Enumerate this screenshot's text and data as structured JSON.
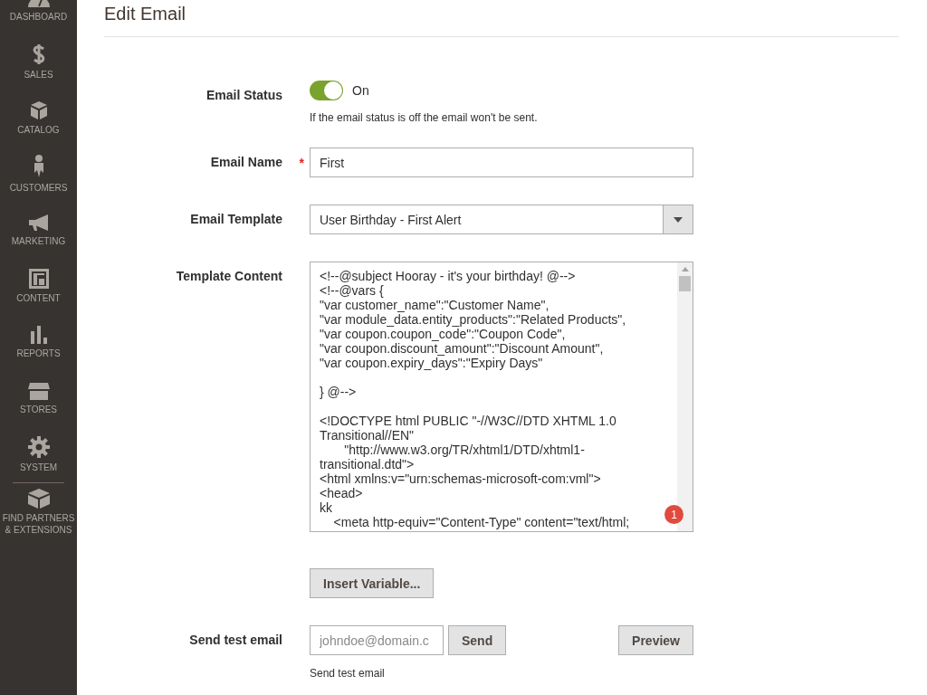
{
  "sidebar": {
    "items": [
      {
        "label": "DASHBOARD",
        "selected": false
      },
      {
        "label": "SALES",
        "selected": false
      },
      {
        "label": "CATALOG",
        "selected": false
      },
      {
        "label": "CUSTOMERS",
        "selected": false
      },
      {
        "label": "MARKETING",
        "selected": false
      },
      {
        "label": "CONTENT",
        "selected": false
      },
      {
        "label": "REPORTS",
        "selected": false
      },
      {
        "label": "STORES",
        "selected": false
      },
      {
        "label": "SYSTEM",
        "selected": false
      },
      {
        "label": "FIND PARTNERS\n& EXTENSIONS",
        "selected": false
      }
    ]
  },
  "page_title": "Edit Email",
  "form": {
    "email_status": {
      "label": "Email Status",
      "on": true,
      "state_label": "On",
      "note": "If the email status is off the email won't be sent."
    },
    "email_name": {
      "label": "Email Name",
      "required_mark": "*",
      "value": "First"
    },
    "email_template": {
      "label": "Email Template",
      "value": "User Birthday - First Alert"
    },
    "template_content": {
      "label": "Template Content",
      "value": "<!--@subject Hooray - it's your birthday! @-->\n<!--@vars {\n\"var customer_name\":\"Customer Name\",\n\"var module_data.entity_products\":\"Related Products\",\n\"var coupon.coupon_code\":\"Coupon Code\",\n\"var coupon.discount_amount\":\"Discount Amount\",\n\"var coupon.expiry_days\":\"Expiry Days\"\n\n} @-->\n\n<!DOCTYPE html PUBLIC \"-//W3C//DTD XHTML 1.0\nTransitional//EN\"\n       \"http://www.w3.org/TR/xhtml1/DTD/xhtml1-\ntransitional.dtd\">\n<html xmlns:v=\"urn:schemas-microsoft-com:vml\">\n<head>\nkk\n    <meta http-equiv=\"Content-Type\" content=\"text/html;",
      "badge": "1"
    },
    "insert_variable_button": "Insert Variable...",
    "send_test": {
      "label": "Send test email",
      "placeholder": "johndoe@domain.c",
      "send_button": "Send",
      "preview_button": "Preview",
      "note": "Send test email"
    }
  }
}
